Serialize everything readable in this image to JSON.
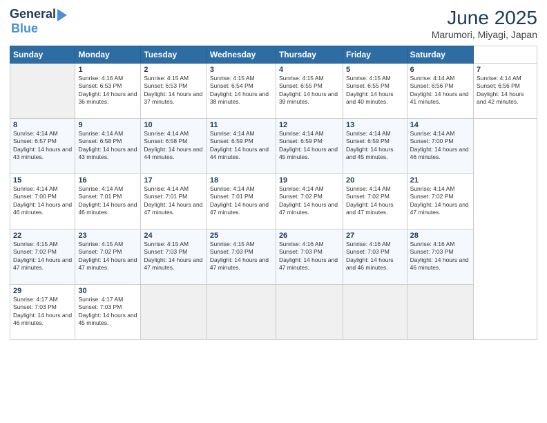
{
  "header": {
    "logo_line1": "General",
    "logo_line2": "Blue",
    "title": "June 2025",
    "subtitle": "Marumori, Miyagi, Japan"
  },
  "calendar": {
    "days_of_week": [
      "Sunday",
      "Monday",
      "Tuesday",
      "Wednesday",
      "Thursday",
      "Friday",
      "Saturday"
    ],
    "weeks": [
      [
        null,
        {
          "num": "1",
          "sunrise": "Sunrise: 4:16 AM",
          "sunset": "Sunset: 6:53 PM",
          "daylight": "Daylight: 14 hours and 36 minutes."
        },
        {
          "num": "2",
          "sunrise": "Sunrise: 4:15 AM",
          "sunset": "Sunset: 6:53 PM",
          "daylight": "Daylight: 14 hours and 37 minutes."
        },
        {
          "num": "3",
          "sunrise": "Sunrise: 4:15 AM",
          "sunset": "Sunset: 6:54 PM",
          "daylight": "Daylight: 14 hours and 38 minutes."
        },
        {
          "num": "4",
          "sunrise": "Sunrise: 4:15 AM",
          "sunset": "Sunset: 6:55 PM",
          "daylight": "Daylight: 14 hours and 39 minutes."
        },
        {
          "num": "5",
          "sunrise": "Sunrise: 4:15 AM",
          "sunset": "Sunset: 6:55 PM",
          "daylight": "Daylight: 14 hours and 40 minutes."
        },
        {
          "num": "6",
          "sunrise": "Sunrise: 4:14 AM",
          "sunset": "Sunset: 6:56 PM",
          "daylight": "Daylight: 14 hours and 41 minutes."
        },
        {
          "num": "7",
          "sunrise": "Sunrise: 4:14 AM",
          "sunset": "Sunset: 6:56 PM",
          "daylight": "Daylight: 14 hours and 42 minutes."
        }
      ],
      [
        {
          "num": "8",
          "sunrise": "Sunrise: 4:14 AM",
          "sunset": "Sunset: 6:57 PM",
          "daylight": "Daylight: 14 hours and 43 minutes."
        },
        {
          "num": "9",
          "sunrise": "Sunrise: 4:14 AM",
          "sunset": "Sunset: 6:58 PM",
          "daylight": "Daylight: 14 hours and 43 minutes."
        },
        {
          "num": "10",
          "sunrise": "Sunrise: 4:14 AM",
          "sunset": "Sunset: 6:58 PM",
          "daylight": "Daylight: 14 hours and 44 minutes."
        },
        {
          "num": "11",
          "sunrise": "Sunrise: 4:14 AM",
          "sunset": "Sunset: 6:59 PM",
          "daylight": "Daylight: 14 hours and 44 minutes."
        },
        {
          "num": "12",
          "sunrise": "Sunrise: 4:14 AM",
          "sunset": "Sunset: 6:59 PM",
          "daylight": "Daylight: 14 hours and 45 minutes."
        },
        {
          "num": "13",
          "sunrise": "Sunrise: 4:14 AM",
          "sunset": "Sunset: 6:59 PM",
          "daylight": "Daylight: 14 hours and 45 minutes."
        },
        {
          "num": "14",
          "sunrise": "Sunrise: 4:14 AM",
          "sunset": "Sunset: 7:00 PM",
          "daylight": "Daylight: 14 hours and 46 minutes."
        }
      ],
      [
        {
          "num": "15",
          "sunrise": "Sunrise: 4:14 AM",
          "sunset": "Sunset: 7:00 PM",
          "daylight": "Daylight: 14 hours and 46 minutes."
        },
        {
          "num": "16",
          "sunrise": "Sunrise: 4:14 AM",
          "sunset": "Sunset: 7:01 PM",
          "daylight": "Daylight: 14 hours and 46 minutes."
        },
        {
          "num": "17",
          "sunrise": "Sunrise: 4:14 AM",
          "sunset": "Sunset: 7:01 PM",
          "daylight": "Daylight: 14 hours and 47 minutes."
        },
        {
          "num": "18",
          "sunrise": "Sunrise: 4:14 AM",
          "sunset": "Sunset: 7:01 PM",
          "daylight": "Daylight: 14 hours and 47 minutes."
        },
        {
          "num": "19",
          "sunrise": "Sunrise: 4:14 AM",
          "sunset": "Sunset: 7:02 PM",
          "daylight": "Daylight: 14 hours and 47 minutes."
        },
        {
          "num": "20",
          "sunrise": "Sunrise: 4:14 AM",
          "sunset": "Sunset: 7:02 PM",
          "daylight": "Daylight: 14 hours and 47 minutes."
        },
        {
          "num": "21",
          "sunrise": "Sunrise: 4:14 AM",
          "sunset": "Sunset: 7:02 PM",
          "daylight": "Daylight: 14 hours and 47 minutes."
        }
      ],
      [
        {
          "num": "22",
          "sunrise": "Sunrise: 4:15 AM",
          "sunset": "Sunset: 7:02 PM",
          "daylight": "Daylight: 14 hours and 47 minutes."
        },
        {
          "num": "23",
          "sunrise": "Sunrise: 4:15 AM",
          "sunset": "Sunset: 7:02 PM",
          "daylight": "Daylight: 14 hours and 47 minutes."
        },
        {
          "num": "24",
          "sunrise": "Sunrise: 4:15 AM",
          "sunset": "Sunset: 7:03 PM",
          "daylight": "Daylight: 14 hours and 47 minutes."
        },
        {
          "num": "25",
          "sunrise": "Sunrise: 4:15 AM",
          "sunset": "Sunset: 7:03 PM",
          "daylight": "Daylight: 14 hours and 47 minutes."
        },
        {
          "num": "26",
          "sunrise": "Sunrise: 4:16 AM",
          "sunset": "Sunset: 7:03 PM",
          "daylight": "Daylight: 14 hours and 47 minutes."
        },
        {
          "num": "27",
          "sunrise": "Sunrise: 4:16 AM",
          "sunset": "Sunset: 7:03 PM",
          "daylight": "Daylight: 14 hours and 46 minutes."
        },
        {
          "num": "28",
          "sunrise": "Sunrise: 4:16 AM",
          "sunset": "Sunset: 7:03 PM",
          "daylight": "Daylight: 14 hours and 46 minutes."
        }
      ],
      [
        {
          "num": "29",
          "sunrise": "Sunrise: 4:17 AM",
          "sunset": "Sunset: 7:03 PM",
          "daylight": "Daylight: 14 hours and 46 minutes."
        },
        {
          "num": "30",
          "sunrise": "Sunrise: 4:17 AM",
          "sunset": "Sunset: 7:03 PM",
          "daylight": "Daylight: 14 hours and 45 minutes."
        },
        null,
        null,
        null,
        null,
        null
      ]
    ]
  }
}
